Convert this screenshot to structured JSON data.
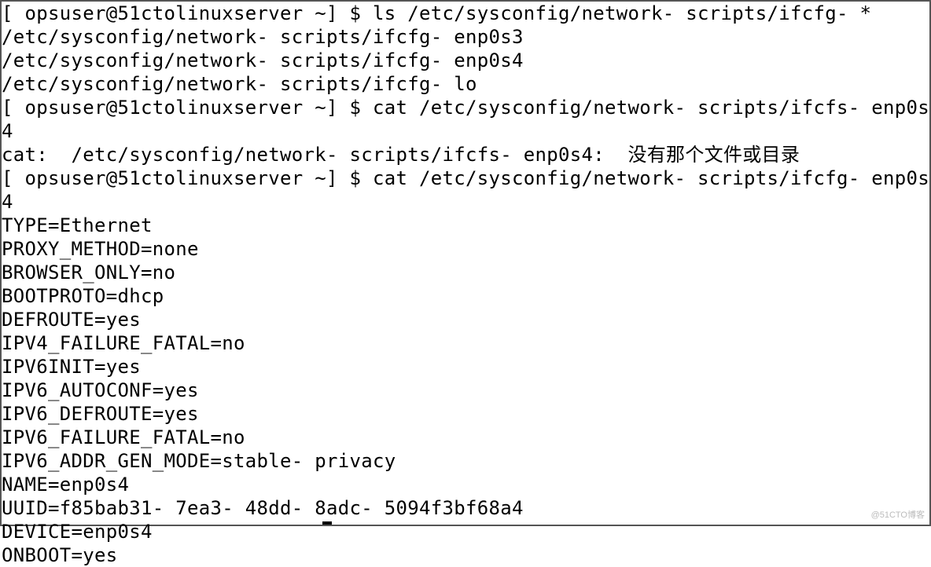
{
  "terminal": {
    "lines": [
      {
        "prompt": "[ opsuser@51ctolinuxserver ~] $ ",
        "cmd": "ls /etc/sysconfig/network- scripts/ifcfg- *"
      },
      {
        "text": "/etc/sysconfig/network- scripts/ifcfg- enp0s3"
      },
      {
        "text": "/etc/sysconfig/network- scripts/ifcfg- enp0s4"
      },
      {
        "text": "/etc/sysconfig/network- scripts/ifcfg- lo"
      },
      {
        "prompt": "[ opsuser@51ctolinuxserver ~] $ ",
        "cmd": "cat /etc/sysconfig/network- scripts/ifcfs- enp0s4"
      },
      {
        "text": "cat:  /etc/sysconfig/network- scripts/ifcfs- enp0s4:  没有那个文件或目录"
      },
      {
        "prompt": "[ opsuser@51ctolinuxserver ~] $ ",
        "cmd": "cat /etc/sysconfig/network- scripts/ifcfg- enp0s4"
      },
      {
        "text": "TYPE=Ethernet"
      },
      {
        "text": "PROXY_METHOD=none"
      },
      {
        "text": "BROWSER_ONLY=no"
      },
      {
        "text": "BOOTPROTO=dhcp"
      },
      {
        "text": "DEFROUTE=yes"
      },
      {
        "text": "IPV4_FAILURE_FATAL=no"
      },
      {
        "text": "IPV6INIT=yes"
      },
      {
        "text": "IPV6_AUTOCONF=yes"
      },
      {
        "text": "IPV6_DEFROUTE=yes"
      },
      {
        "text": "IPV6_FAILURE_FATAL=no"
      },
      {
        "text": "IPV6_ADDR_GEN_MODE=stable- privacy"
      },
      {
        "text": "NAME=enp0s4"
      },
      {
        "text": "UUID=f85bab31- 7ea3- 48dd- 8adc- 5094f3bf68a4"
      },
      {
        "text": "DEVICE=enp0s4"
      },
      {
        "text": "ONBOOT=yes"
      }
    ]
  },
  "watermark": "@51CTO博客"
}
